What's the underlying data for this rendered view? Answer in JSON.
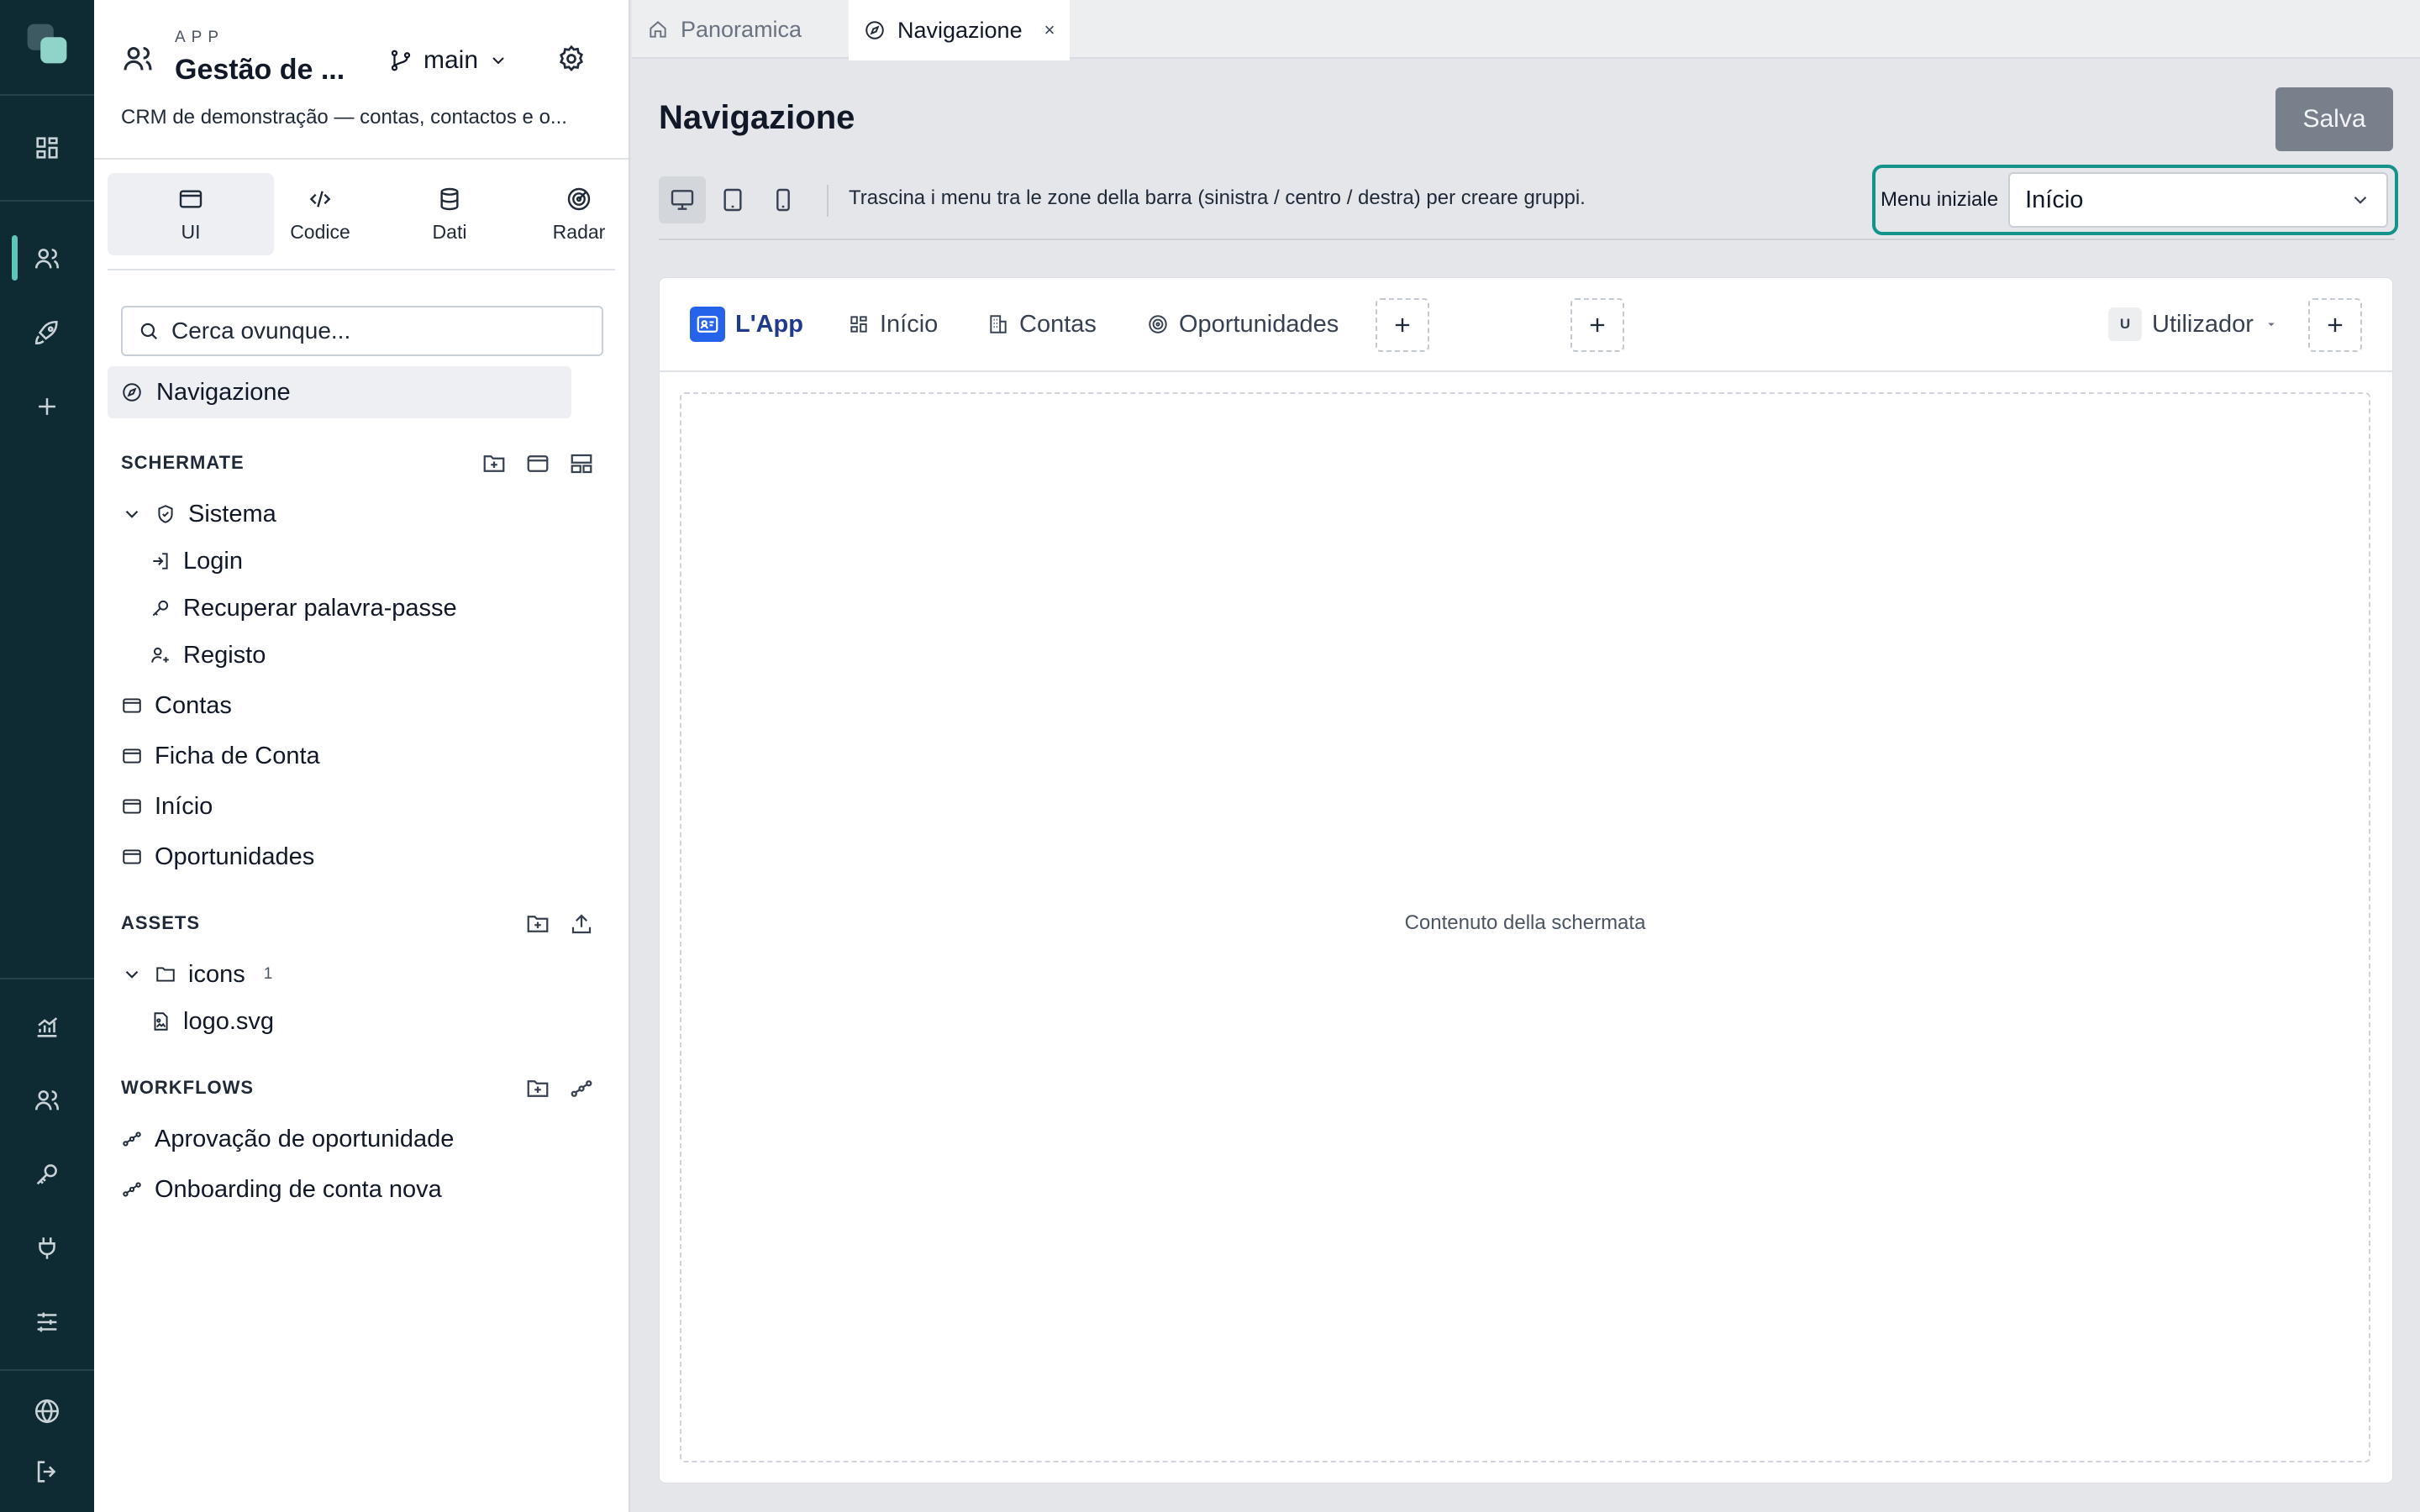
{
  "rail": {
    "items": [
      {
        "name": "dashboard",
        "icon": "grid-icon"
      },
      {
        "name": "users",
        "icon": "users-icon"
      },
      {
        "name": "rocket",
        "icon": "rocket-icon"
      },
      {
        "name": "add",
        "icon": "plus-icon"
      },
      {
        "name": "analytics",
        "icon": "chart-icon"
      },
      {
        "name": "team",
        "icon": "users-icon"
      },
      {
        "name": "keys",
        "icon": "key-icon"
      },
      {
        "name": "plugins",
        "icon": "plug-icon"
      },
      {
        "name": "settings",
        "icon": "sliders-icon"
      },
      {
        "name": "language",
        "icon": "globe-icon"
      },
      {
        "name": "logout",
        "icon": "logout-icon"
      }
    ],
    "accent": "#5fc4b9"
  },
  "panel": {
    "kicker": "APP",
    "app_name": "Gestão de ...",
    "description": "CRM de demonstração — contas, contactos e o...",
    "branch": "main",
    "segments": [
      {
        "label": "UI"
      },
      {
        "label": "Codice"
      },
      {
        "label": "Dati"
      },
      {
        "label": "Radar"
      }
    ],
    "search_placeholder": "Cerca ovunque...",
    "nav_item": "Navigazione",
    "screens_title": "SCHERMATE",
    "screens": {
      "folder": "Sistema",
      "children": [
        "Login",
        "Recuperar palavra-passe",
        "Registo"
      ],
      "items": [
        "Contas",
        "Ficha de Conta",
        "Início",
        "Oportunidades"
      ]
    },
    "assets_title": "ASSETS",
    "assets": {
      "folder": "icons",
      "folder_count": "1",
      "file": "logo.svg"
    },
    "workflows_title": "WORKFLOWS",
    "workflows": [
      "Aprovação de oportunidade",
      "Onboarding de conta nova"
    ]
  },
  "tabs": [
    {
      "label": "Panoramica",
      "icon": "home-icon"
    },
    {
      "label": "Navigazione",
      "icon": "compass-icon",
      "close": "×"
    }
  ],
  "main": {
    "title": "Navigazione",
    "save_label": "Salva",
    "hint": "Trascina i menu tra le zone della barra (sinistra / centro / destra) per creare gruppi.",
    "initial_menu_label": "Menu iniziale",
    "initial_menu_value": "Início",
    "highlight_color": "#14938a"
  },
  "preview": {
    "brand": "L'App",
    "menus": [
      "Início",
      "Contas",
      "Oportunidades"
    ],
    "user_initial": "U",
    "user_label": "Utilizador",
    "content_label": "Contenuto della schermata",
    "brand_color": "#2563eb"
  }
}
